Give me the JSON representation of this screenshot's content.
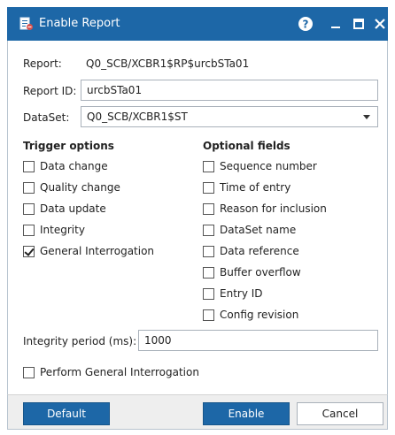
{
  "window": {
    "title": "Enable Report",
    "icons": {
      "app": "report-icon",
      "help": "help-icon",
      "minimize": "minimize-icon",
      "maximize": "maximize-icon",
      "close": "close-icon"
    }
  },
  "form": {
    "report_label": "Report:",
    "report_value": "Q0_SCB/XCBR1$RP$urcbSTa01",
    "report_id_label": "Report ID:",
    "report_id_value": "urcbSTa01",
    "dataset_label": "DataSet:",
    "dataset_value": "Q0_SCB/XCBR1$ST"
  },
  "trigger_options": {
    "heading": "Trigger options",
    "items": [
      {
        "label": "Data change",
        "checked": false
      },
      {
        "label": "Quality change",
        "checked": false
      },
      {
        "label": "Data update",
        "checked": false
      },
      {
        "label": "Integrity",
        "checked": false
      },
      {
        "label": "General Interrogation",
        "checked": true
      }
    ]
  },
  "optional_fields": {
    "heading": "Optional fields",
    "items": [
      {
        "label": "Sequence number",
        "checked": false
      },
      {
        "label": "Time of entry",
        "checked": false
      },
      {
        "label": "Reason for inclusion",
        "checked": false
      },
      {
        "label": "DataSet name",
        "checked": false
      },
      {
        "label": "Data reference",
        "checked": false
      },
      {
        "label": "Buffer overflow",
        "checked": false
      },
      {
        "label": "Entry ID",
        "checked": false
      },
      {
        "label": "Config revision",
        "checked": false
      }
    ]
  },
  "integrity": {
    "label": "Integrity period (ms):",
    "value": "1000"
  },
  "perform_gi": {
    "label": "Perform General Interrogation",
    "checked": false
  },
  "buttons": {
    "default_label": "Default",
    "enable_label": "Enable",
    "cancel_label": "Cancel"
  },
  "colors": {
    "accent": "#1d67a7",
    "footer_bg": "#eeeeee"
  }
}
